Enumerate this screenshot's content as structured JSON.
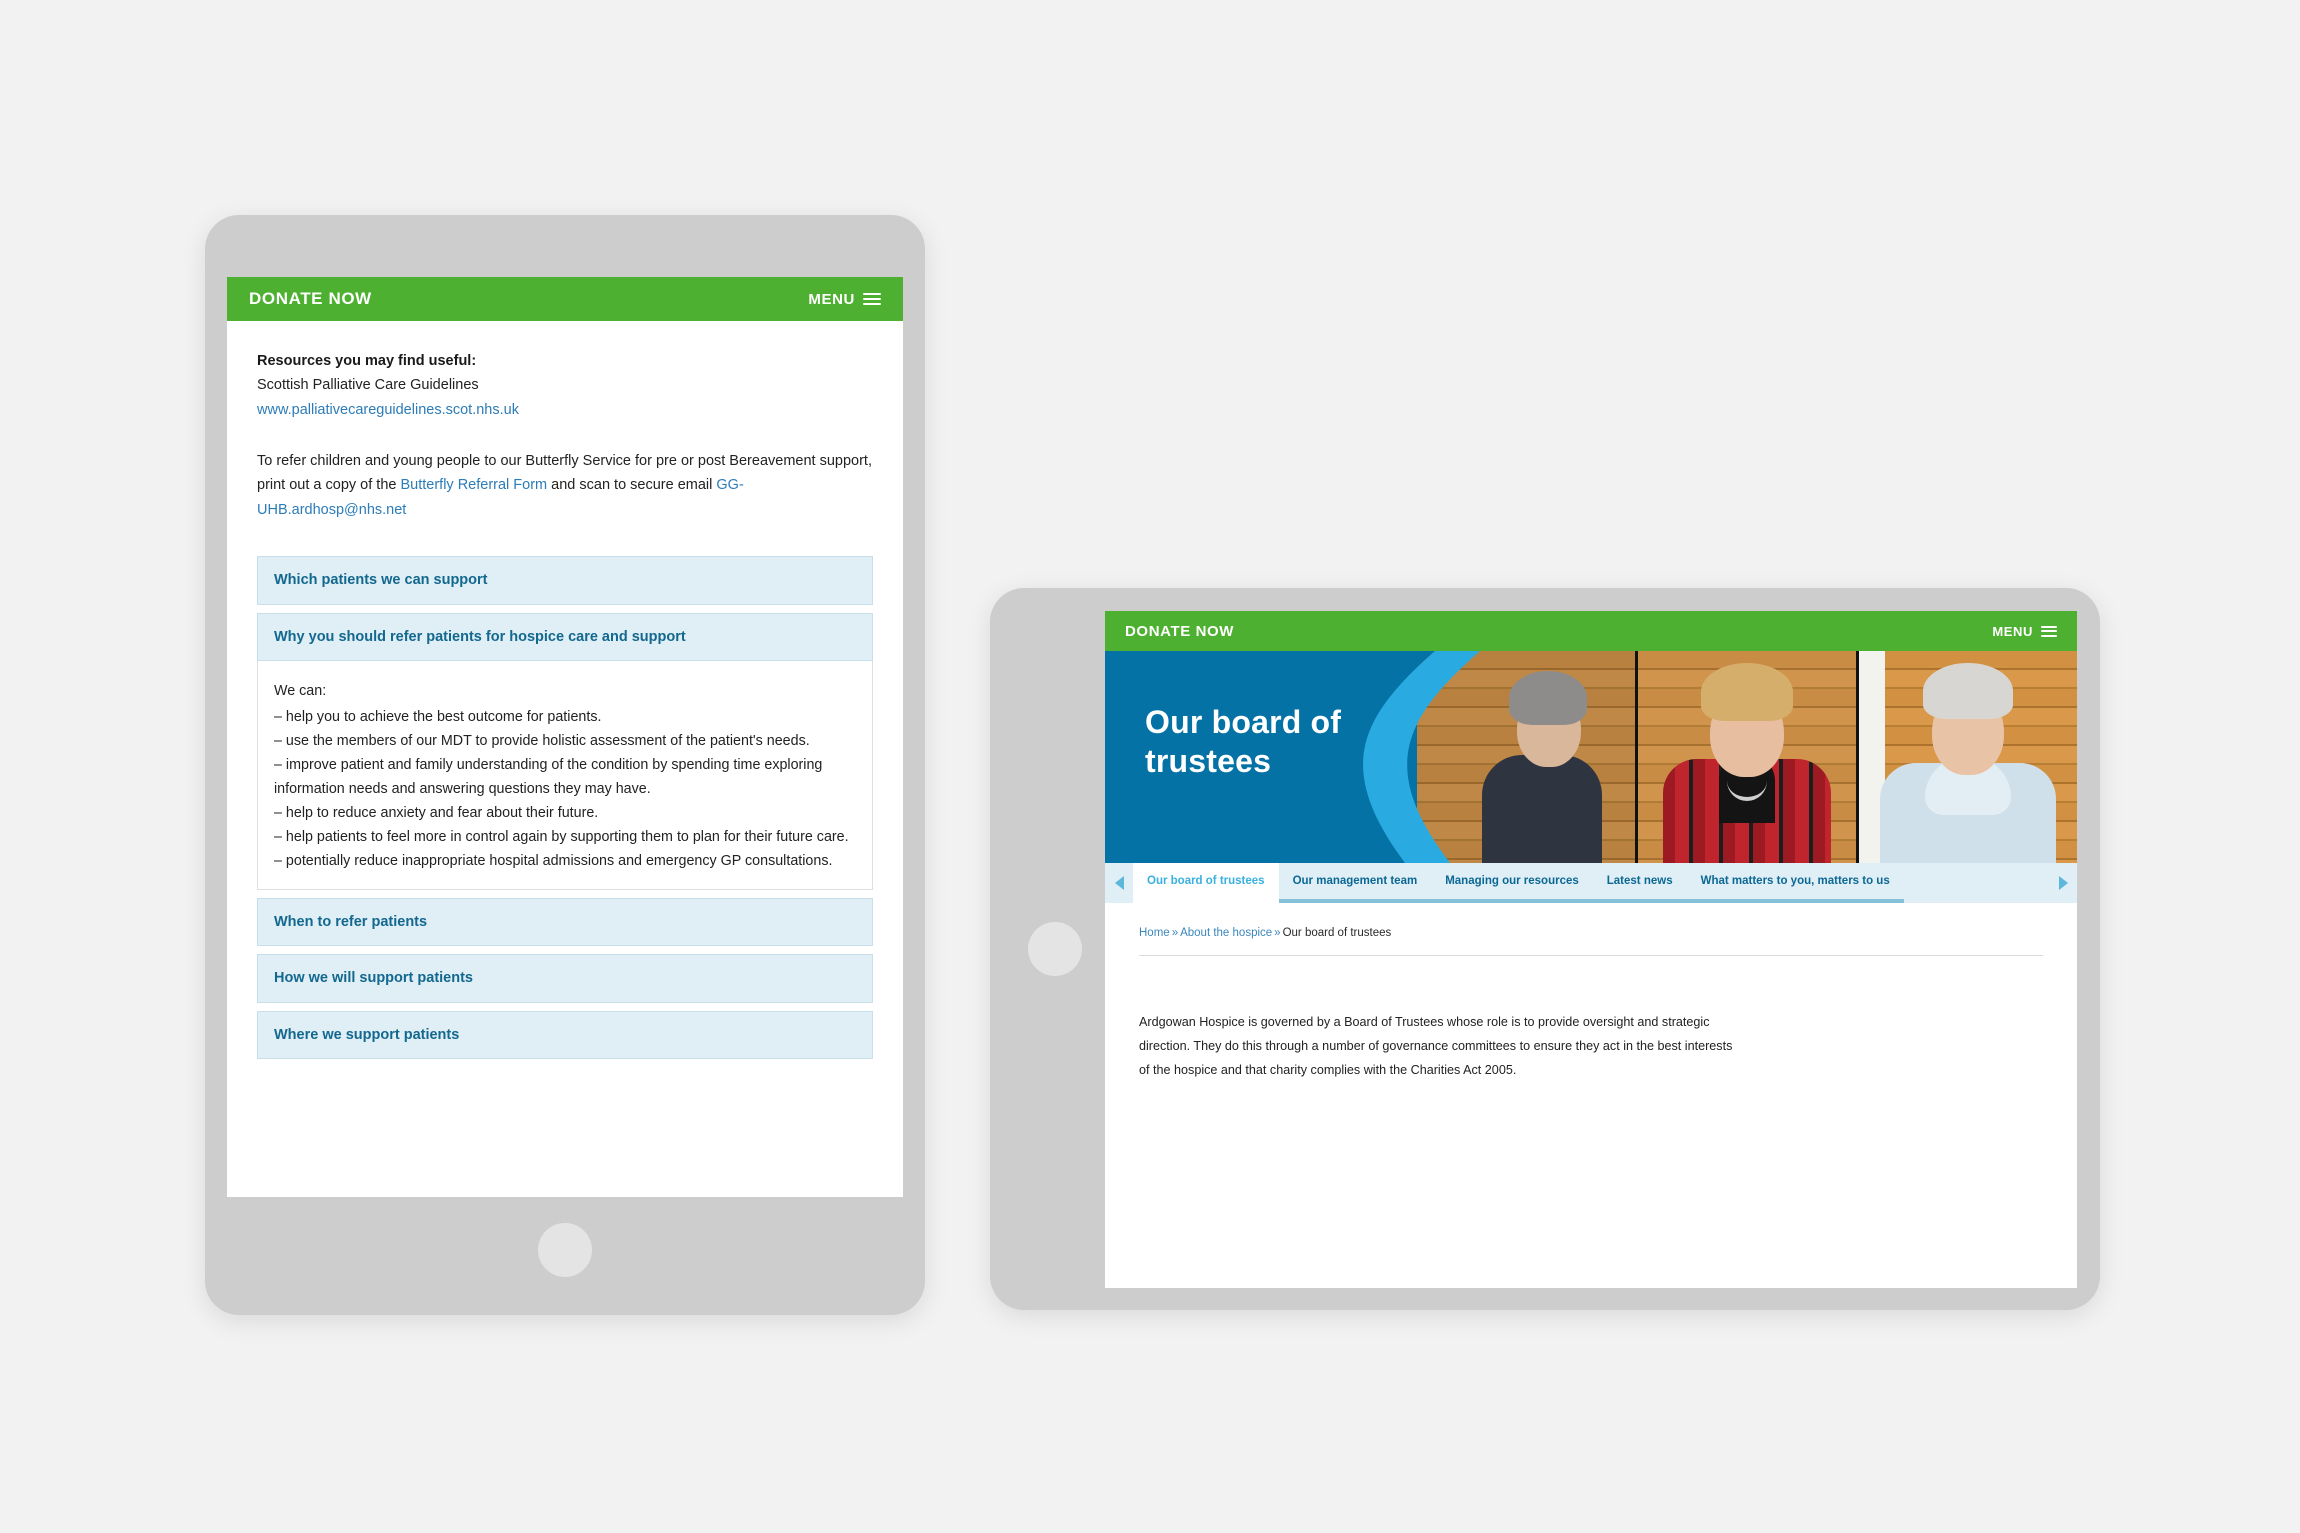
{
  "tablet_left": {
    "topbar": {
      "donate_label": "DONATE NOW",
      "menu_label": "MENU",
      "menu_icon": "hamburger-icon"
    },
    "content": {
      "resources_heading": "Resources you may find useful:",
      "resources_subtitle": "Scottish Palliative Care Guidelines",
      "resources_link": "www.palliativecareguidelines.scot.nhs.uk",
      "referral_text_1": "To refer children and young people to our Butterfly Service for pre or post Bereavement support, print out a copy of the ",
      "referral_link": "Butterfly Referral Form",
      "referral_text_2": " and scan to secure email ",
      "referral_email": "GG-UHB.ardhosp@nhs.net"
    },
    "accordion": [
      {
        "title": "Which patients we can support",
        "expanded": false
      },
      {
        "title": "Why you should refer patients for hospice care and support",
        "expanded": true,
        "body_lead": "We can:",
        "body_items": [
          "–  help you to achieve the best outcome for patients.",
          "–  use the members of our MDT to provide holistic assessment of the patient's needs.",
          "–  improve patient and family understanding of the condition by spending time exploring information needs and answering questions they may have.",
          "–  help to reduce anxiety and fear about their future.",
          "–  help patients to feel more in control again by supporting them to plan for their future care.",
          "–  potentially reduce inappropriate hospital admissions and emergency GP consultations."
        ]
      },
      {
        "title": "When to refer patients",
        "expanded": false
      },
      {
        "title": "How we will support patients",
        "expanded": false
      },
      {
        "title": "Where we support patients",
        "expanded": false
      }
    ]
  },
  "tablet_right": {
    "topbar": {
      "donate_label": "DONATE NOW",
      "menu_label": "MENU",
      "menu_icon": "hamburger-icon"
    },
    "hero": {
      "title_line_1": "Our board of",
      "title_line_2": "trustees",
      "panel_color": "#0572a5",
      "swoosh_color": "#29abe2"
    },
    "tabs": {
      "prev_icon": "chevron-left-icon",
      "next_icon": "chevron-right-icon",
      "items": [
        {
          "label": "Our board of trustees",
          "active": true
        },
        {
          "label": "Our management team",
          "active": false
        },
        {
          "label": "Managing our resources",
          "active": false
        },
        {
          "label": "Latest news",
          "active": false
        },
        {
          "label": "What matters to you, matters to us",
          "active": false
        }
      ]
    },
    "breadcrumb": {
      "home": "Home",
      "sep": "»",
      "parent": "About the hospice",
      "current": "Our board of trustees"
    },
    "body_paragraph": "Ardgowan Hospice is governed by a Board of Trustees whose role is to provide oversight and strategic direction. They do this through a number of governance committees to ensure they act in the best interests of the hospice and that charity complies with the Charities Act 2005."
  },
  "theme": {
    "green": "#4eb031",
    "blue_dark": "#0572a5",
    "blue_light": "#29abe2",
    "accordion_bg": "#e0eef5",
    "accordion_text": "#12688f",
    "link": "#2c7cb8",
    "frame": "#cdcdcd",
    "page_bg": "#f2f2f2"
  }
}
